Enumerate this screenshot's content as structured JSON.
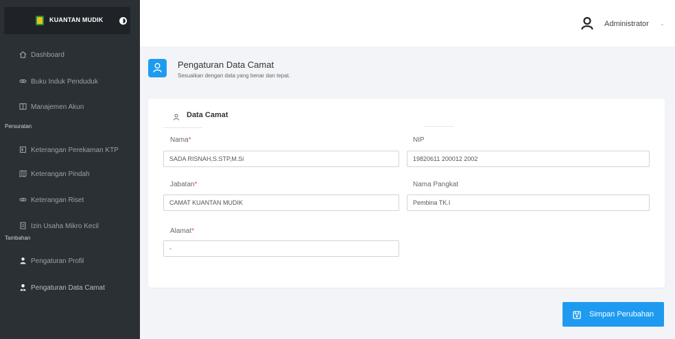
{
  "brand": {
    "name": "KUANTAN MUDIK"
  },
  "sidebar": {
    "items": [
      {
        "label": "Dashboard",
        "icon": "home-icon"
      },
      {
        "label": "Buku Induk Penduduk",
        "icon": "link-icon"
      },
      {
        "label": "Manajemen Akun",
        "icon": "columns-icon"
      }
    ],
    "sections": [
      {
        "title": "Persuratan",
        "items": [
          {
            "label": "Keterangan Perekaman KTP",
            "icon": "id-card-icon"
          },
          {
            "label": "Keterangan Pindah",
            "icon": "map-icon"
          },
          {
            "label": "Keterangan Riset",
            "icon": "link-icon"
          },
          {
            "label": "Izin Usaha Mikro Kecil",
            "icon": "document-icon"
          }
        ]
      },
      {
        "title": "Tambahan",
        "items": [
          {
            "label": "Pengaturan Profil",
            "icon": "user-icon"
          },
          {
            "label": "Pengaturan Data Camat",
            "icon": "user-tie-icon"
          }
        ]
      }
    ]
  },
  "header": {
    "user": "Administrator"
  },
  "page": {
    "title": "Pengaturan Data Camat",
    "subtitle": "Sesuaikan dengan data yang benar dan tepat."
  },
  "card": {
    "title": "Data Camat"
  },
  "form": {
    "nama": {
      "label": "Nama",
      "value": "SADA RISNAH,S.STP,M.Si"
    },
    "nip": {
      "label": "NIP",
      "value": "19820611 200012 2002"
    },
    "jabatan": {
      "label": "Jabatan",
      "value": "CAMAT KUANTAN MUDIK"
    },
    "pangkat": {
      "label": "Nama Pangkat",
      "value": "Pembina TK.I"
    },
    "alamat": {
      "label": "Alamat",
      "value": "-"
    },
    "required_mark": "*"
  },
  "actions": {
    "save": "Simpan Perubahan"
  },
  "colors": {
    "sidebar": "#2b3035",
    "accent": "#1e9bf0",
    "required": "#e74c3c"
  }
}
